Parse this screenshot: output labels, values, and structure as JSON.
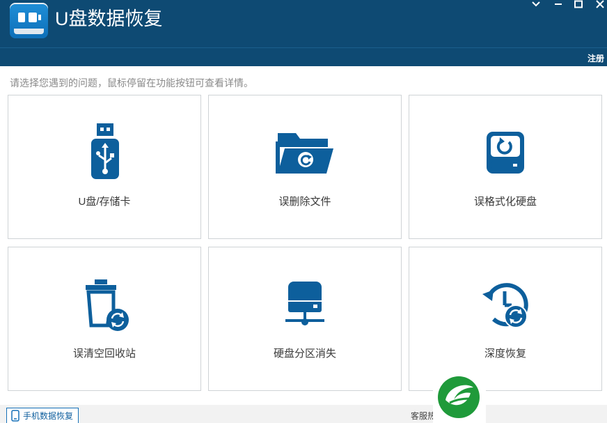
{
  "window": {
    "title": "U盘数据恢复",
    "register_label": "注册",
    "controls": [
      "⌄",
      "—",
      "□",
      "✕"
    ]
  },
  "hint": "请选择您遇到的问题，鼠标停留在功能按钮可查看详情。",
  "tiles": [
    {
      "label": "U盘/存储卡",
      "icon": "usb-drive-icon"
    },
    {
      "label": "误删除文件",
      "icon": "folder-restore-icon"
    },
    {
      "label": "误格式化硬盘",
      "icon": "disk-refresh-icon"
    },
    {
      "label": "误清空回收站",
      "icon": "recycle-bin-restore-icon"
    },
    {
      "label": "硬盘分区消失",
      "icon": "disk-partition-icon"
    },
    {
      "label": "深度恢复",
      "icon": "history-restore-icon"
    }
  ],
  "footer": {
    "mobile_recovery_label": "手机数据恢复",
    "service_label": "客服热线"
  },
  "colors": {
    "title_bar": "#0e4a73",
    "icon_blue": "#0d5f9c",
    "tile_border": "#cfd3d6"
  }
}
